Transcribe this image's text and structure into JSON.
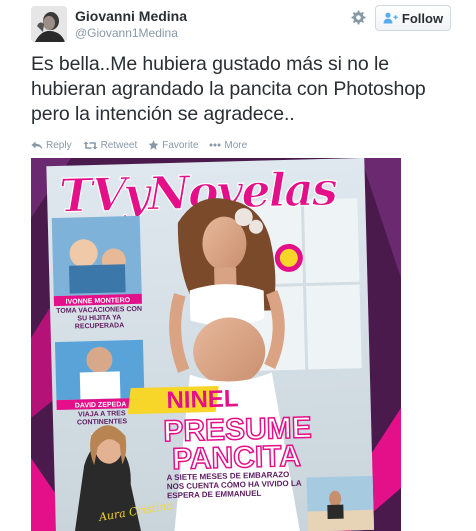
{
  "user": {
    "display_name": "Giovanni Medina",
    "handle": "@Giovann1Medina"
  },
  "follow_button": {
    "label": "Follow",
    "icon": "add-user-icon"
  },
  "settings_icon": "gear-icon",
  "tweet": {
    "text": "Es bella..Me hubiera gustado más si no le hubieran agrandado la pancita con Photoshop pero la intención se agradece.."
  },
  "actions": [
    {
      "label": "Reply",
      "icon": "reply-icon"
    },
    {
      "label": "Retweet",
      "icon": "retweet-icon"
    },
    {
      "label": "Favorite",
      "icon": "star-icon"
    },
    {
      "label": "More",
      "icon": "more-dots-icon"
    }
  ],
  "magazine": {
    "masthead": "TVyNovelas",
    "sidebar_name_1": "IVONNE MONTERO",
    "sidebar_headline_1": "TOMA VACACIONES CON SU HIJITA YA RECUPERADA",
    "sidebar_name_2": "DAVID ZEPEDA",
    "sidebar_headline_2": "VIAJA A TRES CONTINENTES",
    "signature_name": "Aura Cristina Geithner",
    "cover_name": "NINEL",
    "headline_1": "PRESUME",
    "headline_2": "PANCITA",
    "subheadline": "A SIETE MESES DE EMBARAZO NOS CUENTA CÓMO HA VIVIDO LA ESPERA DE EMMANUEL"
  },
  "colors": {
    "text": "#292f33",
    "muted": "#8899a6",
    "accent_blue": "#2b7bb9",
    "magazine_pink": "#e3108a",
    "magazine_purple": "#5a1b5f",
    "magazine_yellow": "#f7d629"
  }
}
